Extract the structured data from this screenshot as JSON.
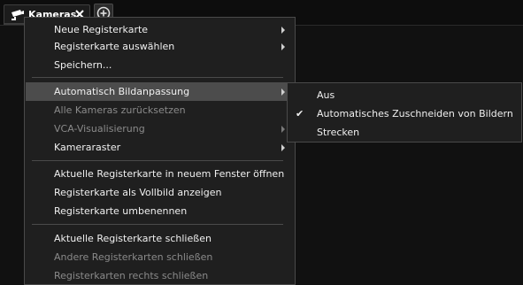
{
  "tab": {
    "label": "Kameras"
  },
  "menu": {
    "items": [
      {
        "label": "Neue Registerkarte",
        "submenu": true,
        "disabled": false
      },
      {
        "label": "Registerkarte auswählen",
        "submenu": true,
        "disabled": false
      },
      {
        "label": "Speichern...",
        "submenu": false,
        "disabled": false
      },
      {
        "label": "Automatisch Bildanpassung",
        "submenu": true,
        "disabled": false,
        "highlighted": true
      },
      {
        "label": "Alle Kameras zurücksetzen",
        "submenu": false,
        "disabled": true
      },
      {
        "label": "VCA-Visualisierung",
        "submenu": true,
        "disabled": true
      },
      {
        "label": "Kameraraster",
        "submenu": true,
        "disabled": false
      },
      {
        "label": "Aktuelle Registerkarte in neuem Fenster öffnen",
        "submenu": false,
        "disabled": false
      },
      {
        "label": "Registerkarte als Vollbild anzeigen",
        "submenu": false,
        "disabled": false
      },
      {
        "label": "Registerkarte umbenennen",
        "submenu": false,
        "disabled": false
      },
      {
        "label": "Aktuelle Registerkarte schließen",
        "submenu": false,
        "disabled": false
      },
      {
        "label": "Andere Registerkarten schließen",
        "submenu": false,
        "disabled": true
      },
      {
        "label": "Registerkarten rechts schließen",
        "submenu": false,
        "disabled": true
      }
    ]
  },
  "submenu": {
    "items": [
      {
        "label": "Aus",
        "checked": false
      },
      {
        "label": "Automatisches Zuschneiden von Bildern",
        "checked": true
      },
      {
        "label": "Strecken",
        "checked": false
      }
    ]
  },
  "icons": {
    "tab_icon": "security-camera-icon",
    "close_icon": "close-icon",
    "add_icon": "add-circle-icon",
    "submenu_arrow": "chevron-right-icon",
    "check_icon": "checkmark-icon"
  },
  "colors": {
    "background": "#111111",
    "menu_background": "#1f1f1f",
    "highlight": "#4c4c4c",
    "text": "#f0f0f0",
    "disabled_text": "#8a8a8a",
    "border": "#4a4a4a"
  }
}
